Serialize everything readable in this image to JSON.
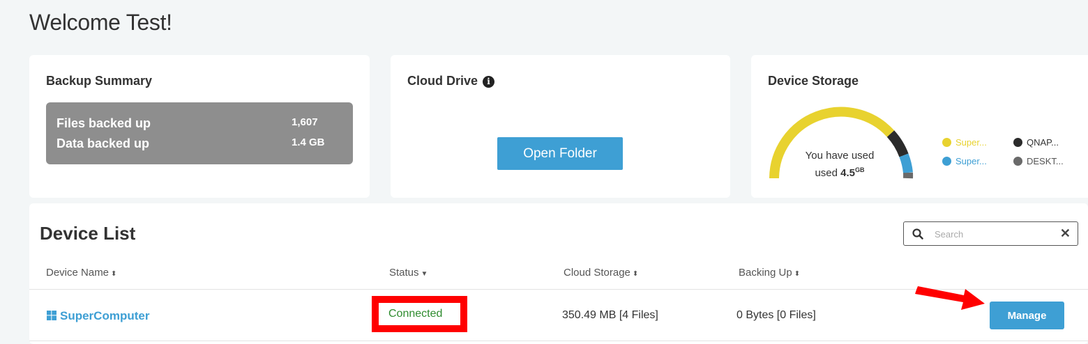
{
  "welcome": "Welcome Test!",
  "backup_summary": {
    "title": "Backup Summary",
    "rows": [
      {
        "label": "Files backed up",
        "value": "1,607"
      },
      {
        "label": "Data backed up",
        "value": "1.4 GB"
      }
    ]
  },
  "cloud_drive": {
    "title": "Cloud Drive",
    "info_icon": "info-icon",
    "open_folder_label": "Open Folder"
  },
  "device_storage": {
    "title": "Device Storage",
    "used_text": "You have used",
    "used_prefix": "used",
    "used_value": "4.5",
    "used_unit": "GB",
    "legend": [
      {
        "label": "Super...",
        "color": "#e8d22f"
      },
      {
        "label": "QNAP...",
        "color": "#2b2b2b"
      },
      {
        "label": "Super...",
        "color": "#3e9fd4"
      },
      {
        "label": "DESKT...",
        "color": "#6a6a6a"
      }
    ]
  },
  "device_list": {
    "title": "Device List",
    "search_placeholder": "Search",
    "columns": [
      {
        "label": "Device Name",
        "sort_icon": "sort-both-icon"
      },
      {
        "label": "Status",
        "sort_icon": "sort-down-icon"
      },
      {
        "label": "Cloud Storage",
        "sort_icon": "sort-both-icon"
      },
      {
        "label": "Backing Up",
        "sort_icon": "sort-both-icon"
      }
    ],
    "rows": [
      {
        "name": "SuperComputer",
        "os_icon": "windows-icon",
        "status": "Connected",
        "cloud_storage": "350.49 MB [4 Files]",
        "backing_up": "0 Bytes [0 Files]",
        "action": "Manage"
      }
    ]
  },
  "colors": {
    "accent": "#3e9fd4",
    "status_connected": "#2e8b2e",
    "highlight": "#ff0000"
  }
}
